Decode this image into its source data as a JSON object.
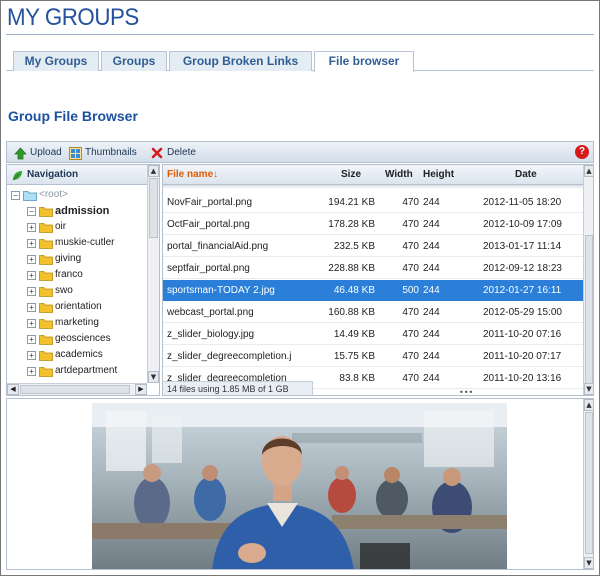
{
  "page": {
    "title": "MY GROUPS"
  },
  "tabs": [
    {
      "label": "My Groups",
      "active": false
    },
    {
      "label": "Groups",
      "active": false
    },
    {
      "label": "Group Broken Links",
      "active": false
    },
    {
      "label": "File browser",
      "active": true
    }
  ],
  "section": {
    "title": "Group File Browser"
  },
  "toolbar": {
    "upload_label": "Upload",
    "thumbnails_label": "Thumbnails",
    "delete_label": "Delete",
    "help_label": "?"
  },
  "navigation": {
    "header": "Navigation",
    "root_label": "<root>",
    "folders": [
      {
        "label": "admission",
        "selected": true
      },
      {
        "label": "oir"
      },
      {
        "label": "muskie-cutler"
      },
      {
        "label": "giving"
      },
      {
        "label": "franco"
      },
      {
        "label": "swo"
      },
      {
        "label": "orientation"
      },
      {
        "label": "marketing"
      },
      {
        "label": "geosciences"
      },
      {
        "label": "academics"
      },
      {
        "label": "artdepartment"
      }
    ]
  },
  "files": {
    "columns": {
      "name": "File name↓",
      "size": "Size",
      "width": "Width",
      "height": "Height",
      "date": "Date"
    },
    "rows": [
      {
        "name": "NovFair_portal.png",
        "size": "194.21 KB",
        "width": "470",
        "height": "244",
        "date": "2012-11-05 18:20",
        "selected": false
      },
      {
        "name": "OctFair_portal.png",
        "size": "178.28 KB",
        "width": "470",
        "height": "244",
        "date": "2012-10-09 17:09",
        "selected": false
      },
      {
        "name": "portal_financialAid.png",
        "size": "232.5 KB",
        "width": "470",
        "height": "244",
        "date": "2013-01-17 11:14",
        "selected": false
      },
      {
        "name": "septfair_portal.png",
        "size": "228.88 KB",
        "width": "470",
        "height": "244",
        "date": "2012-09-12 18:23",
        "selected": false
      },
      {
        "name": "sportsman-TODAY 2.jpg",
        "size": "46.48 KB",
        "width": "500",
        "height": "244",
        "date": "2012-01-27 16:11",
        "selected": true
      },
      {
        "name": "webcast_portal.png",
        "size": "160.88 KB",
        "width": "470",
        "height": "244",
        "date": "2012-05-29 15:00",
        "selected": false
      },
      {
        "name": "z_slider_biology.jpg",
        "size": "14.49 KB",
        "width": "470",
        "height": "244",
        "date": "2011-10-20 07:16",
        "selected": false
      },
      {
        "name": "z_slider_degreecompletion.j",
        "size": "15.75 KB",
        "width": "470",
        "height": "244",
        "date": "2011-10-20 07:17",
        "selected": false
      },
      {
        "name": "z_slider_degreecompletion_",
        "size": "83.8 KB",
        "width": "470",
        "height": "244",
        "date": "2011-10-20 13:16",
        "selected": false
      }
    ],
    "status": "14 files using 1.85 MB of 1 GB"
  },
  "colors": {
    "title": "#24529c",
    "selection": "#2b7fd9",
    "sort_column": "#e35a00",
    "folder": "#f2c12e"
  }
}
